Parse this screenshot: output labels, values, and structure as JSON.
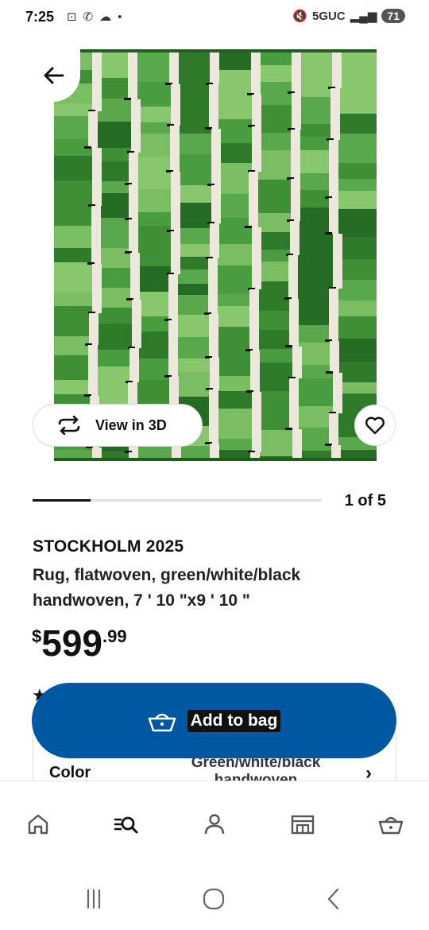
{
  "status_bar": {
    "time": "7:25",
    "left_icons": [
      "screenshot-icon",
      "missed-call-icon",
      "cloud-icon",
      "dot-icon"
    ],
    "network": "5GUC",
    "battery": "71"
  },
  "product": {
    "image_alt": "Green white black flatwoven rug",
    "view3d_label": "View in 3D",
    "pager_text": "1 of 5",
    "progress_fraction": 0.2,
    "name": "STOCKHOLM 2025",
    "description": "Rug, flatwoven, green/white/black handwoven, 7 ' 10 \"x9 ' 10 \"",
    "price": {
      "currency": "$",
      "integer": "599",
      "decimal": ".99"
    },
    "rating_symbol": "★"
  },
  "color_row": {
    "label": "Color",
    "value": "Green/white/black handwoven"
  },
  "add_to_bag": {
    "label": "Add to bag",
    "color": "#0058a3"
  },
  "bottom_nav": {
    "items": [
      "home-icon",
      "search-icon",
      "profile-icon",
      "store-icon",
      "bag-icon"
    ]
  },
  "system_nav": {
    "items": [
      "recents-icon",
      "home-icon",
      "back-icon"
    ]
  }
}
